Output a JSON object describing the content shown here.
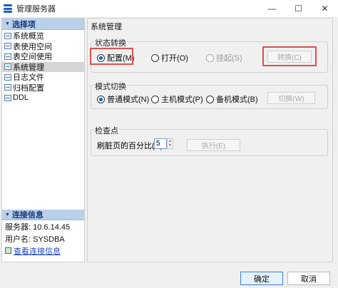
{
  "window": {
    "title": "管理服务器"
  },
  "sidebar": {
    "header": "选择项",
    "items": [
      {
        "label": "系统概览"
      },
      {
        "label": "表使用空间"
      },
      {
        "label": "表空间使用"
      },
      {
        "label": "系统管理"
      },
      {
        "label": "日志文件"
      },
      {
        "label": "归档配置"
      },
      {
        "label": "DDL"
      }
    ],
    "selected_index": 3,
    "connection": {
      "header": "连接信息",
      "server": "服务器: 10.6.14.45",
      "user": "用户名: SYSDBA",
      "view_link": "查看连接信息"
    }
  },
  "content": {
    "title": "系统管理",
    "state_switch": {
      "label": "状态转换",
      "options": [
        "配置(M)",
        "打开(O)",
        "挂起(S)"
      ],
      "selected": "配置(M)",
      "button": "转换(C)"
    },
    "mode_switch": {
      "label": "模式切换",
      "options": [
        "普通模式(N)",
        "主机模式(P)",
        "备机模式(B)"
      ],
      "selected": "普通模式(N)",
      "button": "切换(W)"
    },
    "checkpoint": {
      "label": "检查点",
      "field_label": "刷脏页的百分比(R):",
      "value": "5",
      "button": "执行(E)"
    }
  },
  "footer": {
    "ok": "确定",
    "cancel": "取消"
  },
  "colors": {
    "accent": "#0b5fcf",
    "highlight": "#e0504f",
    "panel_header": "#b9cfea"
  }
}
